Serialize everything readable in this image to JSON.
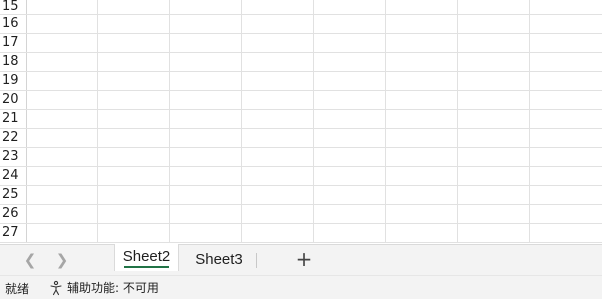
{
  "grid": {
    "rows": [
      "15",
      "16",
      "17",
      "18",
      "19",
      "20",
      "21",
      "22",
      "23",
      "24",
      "25",
      "26",
      "27"
    ]
  },
  "tabs": {
    "prev_icon": "chevron-left-icon",
    "next_icon": "chevron-right-icon",
    "items": [
      {
        "label": "Sheet2",
        "active": true
      },
      {
        "label": "Sheet3",
        "active": false
      }
    ],
    "add_label": "+"
  },
  "status": {
    "ready": "就绪",
    "accessibility": "辅助功能: 不可用",
    "accessibility_icon": "accessibility-icon"
  },
  "colors": {
    "accent": "#217346",
    "gridline": "#e1e1e1",
    "bar_background": "#f3f3f3"
  }
}
